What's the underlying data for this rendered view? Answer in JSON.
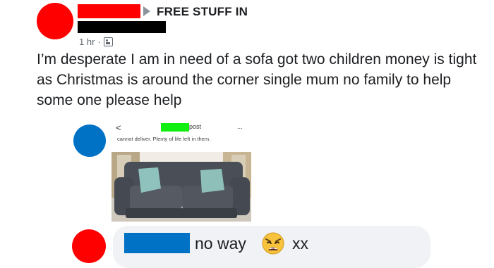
{
  "post": {
    "group_name": "FREE STUFF IN",
    "time": "1 hr",
    "separator": "·",
    "audience_icon": "group-audience-icon",
    "body": "I’m desperate I am in need of a sofa got two children money is tight as Christmas is around the corner single mum no family to help some one please help"
  },
  "comments": [
    {
      "screenshot": {
        "back_glyph": "<",
        "name_suffix": "post",
        "more_glyph": "...",
        "caption": "cannot deliver. Plenty of life left in them."
      }
    },
    {
      "text": "no way",
      "emoji": "weary-face",
      "suffix": "xx"
    }
  ],
  "colors": {
    "redact_red": "#ff0000",
    "redact_blue": "#0072c6",
    "redact_green": "#10ef10",
    "redact_black": "#000000",
    "bubble": "#f0f2f5",
    "meta_gray": "#606770"
  }
}
